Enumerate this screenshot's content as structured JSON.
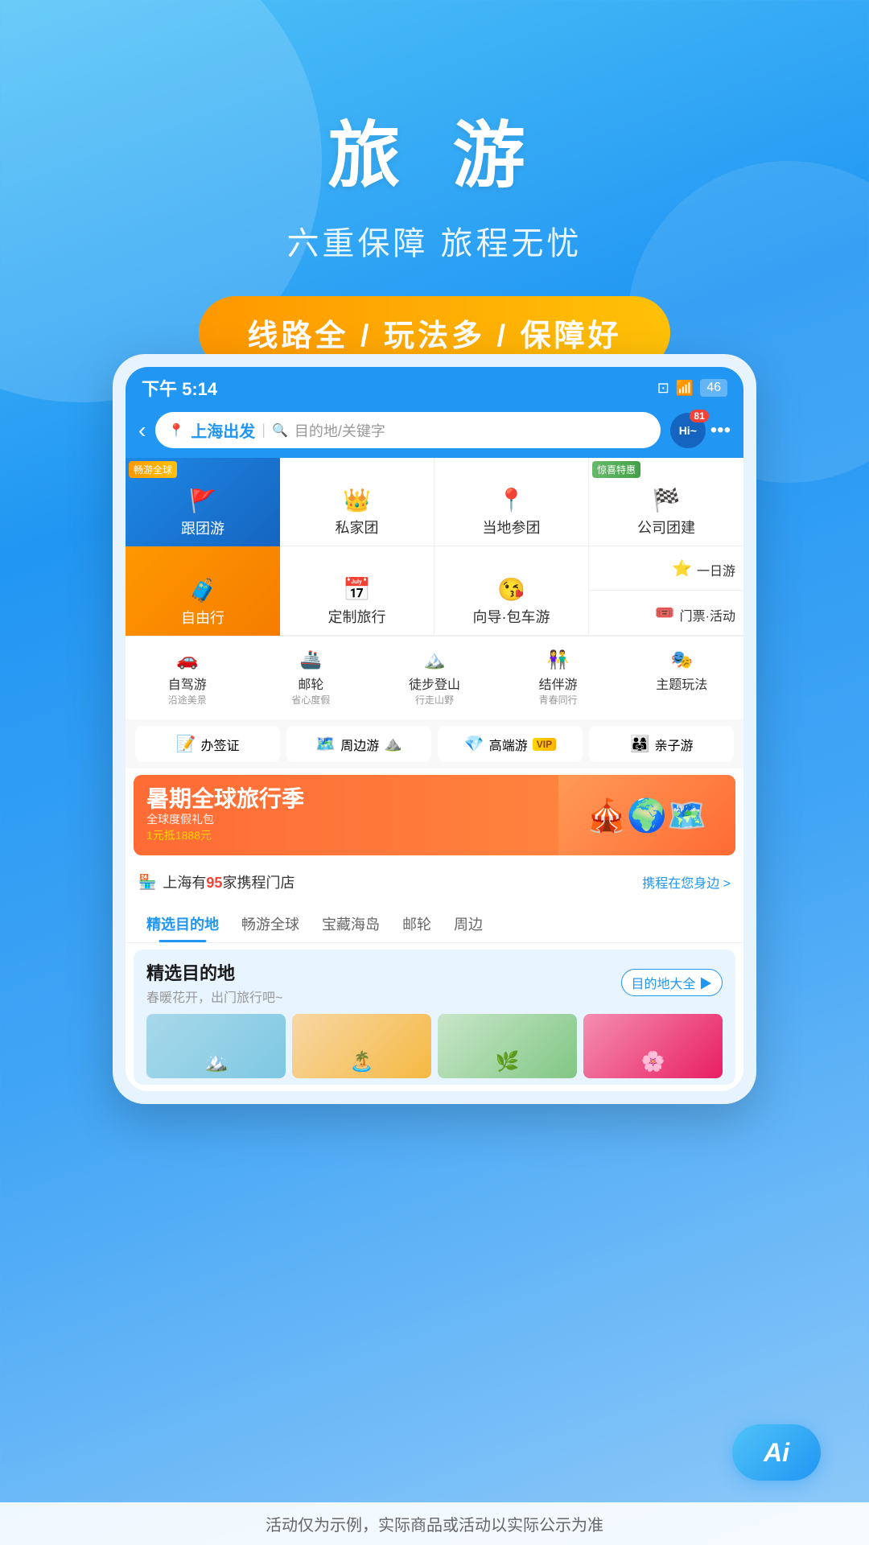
{
  "app": {
    "title": "旅游"
  },
  "hero": {
    "title": "旅 游",
    "subtitle": "六重保障 旅程无忧",
    "badge": "线路全 / 玩法多 / 保障好"
  },
  "status_bar": {
    "time": "下午 5:14",
    "battery": "46",
    "hi_label": "Hi~",
    "notification_count": "81"
  },
  "search": {
    "location": "上海出发",
    "placeholder": "目的地/关键字",
    "back_label": "‹"
  },
  "menu": {
    "row1": [
      {
        "label": "跟团游",
        "tag": "畅游全球",
        "icon": "🚩",
        "bg": "blue"
      },
      {
        "label": "私家团",
        "icon": "👑",
        "bg": "white"
      },
      {
        "label": "当地参团",
        "icon": "📍",
        "bg": "white"
      },
      {
        "label": "公司团建",
        "tag": "惊喜特惠",
        "icon": "🏁",
        "bg": "white"
      }
    ],
    "row2": [
      {
        "label": "自由行",
        "icon": "🧳",
        "bg": "orange"
      },
      {
        "label": "定制旅行",
        "icon": "📅",
        "bg": "white"
      },
      {
        "label": "向导·包车游",
        "icon": "😘",
        "bg": "white"
      },
      {
        "label": "一日游",
        "sublabel": "",
        "icon": "⭐",
        "bg": "white"
      },
      {
        "label": "门票·活动",
        "icon": "🎟️",
        "bg": "white"
      }
    ],
    "row3": [
      {
        "label": "自驾游",
        "sublabel": "沿途美景"
      },
      {
        "label": "邮轮",
        "sublabel": "省心度假"
      },
      {
        "label": "徒步登山",
        "sublabel": "行走山野"
      },
      {
        "label": "结伴游",
        "sublabel": "青春同行"
      },
      {
        "label": "主题玩法",
        "sublabel": ""
      }
    ]
  },
  "services": [
    {
      "label": "办签证",
      "icon": "📝"
    },
    {
      "label": "周边游",
      "icon": "🗺️"
    },
    {
      "label": "高端游",
      "vip": true,
      "icon": "💎"
    },
    {
      "label": "亲子游",
      "icon": "👨‍👩‍👧"
    }
  ],
  "banner": {
    "main_text": "暑期全球旅行季",
    "sub_text": "全球度假礼包",
    "discount": "1元抵1888元"
  },
  "store": {
    "icon": "🏪",
    "text": "上海有",
    "count": "95",
    "suffix": "家携程门店",
    "link": "携程在您身边 >"
  },
  "tabs": [
    {
      "label": "精选目的地",
      "active": true
    },
    {
      "label": "畅游全球",
      "active": false
    },
    {
      "label": "宝藏海岛",
      "active": false
    },
    {
      "label": "邮轮",
      "active": false
    },
    {
      "label": "周边",
      "active": false
    }
  ],
  "destination": {
    "title": "精选目的地",
    "subtitle": "春暖花开，出门旅行吧~",
    "all_btn": "目的地大全 ▶"
  },
  "disclaimer": "活动仅为示例，实际商品或活动以实际公示为准",
  "ai_button": "Ai"
}
